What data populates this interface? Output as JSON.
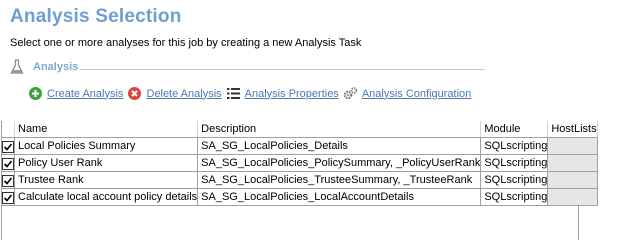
{
  "header": {
    "title": "Analysis Selection",
    "subtitle": "Select one or more analyses for this job by creating a new Analysis Task"
  },
  "section": {
    "label": "Analysis",
    "icon": "flask-icon"
  },
  "toolbar": {
    "create_label": "Create Analysis",
    "delete_label": "Delete Analysis",
    "properties_label": "Analysis Properties",
    "configuration_label": "Analysis Configuration"
  },
  "table": {
    "columns": [
      "",
      "Name",
      "Description",
      "Module",
      "HostLists"
    ],
    "rows": [
      {
        "checked": true,
        "name": "Local Policies Summary",
        "description": "SA_SG_LocalPolicies_Details",
        "module": "SQLscripting",
        "hostlists": ""
      },
      {
        "checked": true,
        "name": "Policy User Rank",
        "description": "SA_SG_LocalPolicies_PolicySummary, _PolicyUserRank",
        "module": "SQLscripting",
        "hostlists": ""
      },
      {
        "checked": true,
        "name": "Trustee Rank",
        "description": "SA_SG_LocalPolicies_TrusteeSummary, _TrusteeRank",
        "module": "SQLscripting",
        "hostlists": ""
      },
      {
        "checked": true,
        "name": "Calculate local account policy details",
        "description": "SA_SG_LocalPolicies_LocalAccountDetails",
        "module": "SQLscripting",
        "hostlists": ""
      }
    ]
  },
  "colors": {
    "title": "#6f9fd0",
    "link": "#4a78b0",
    "create_icon": "#3aa33a",
    "delete_icon": "#d9463e"
  }
}
